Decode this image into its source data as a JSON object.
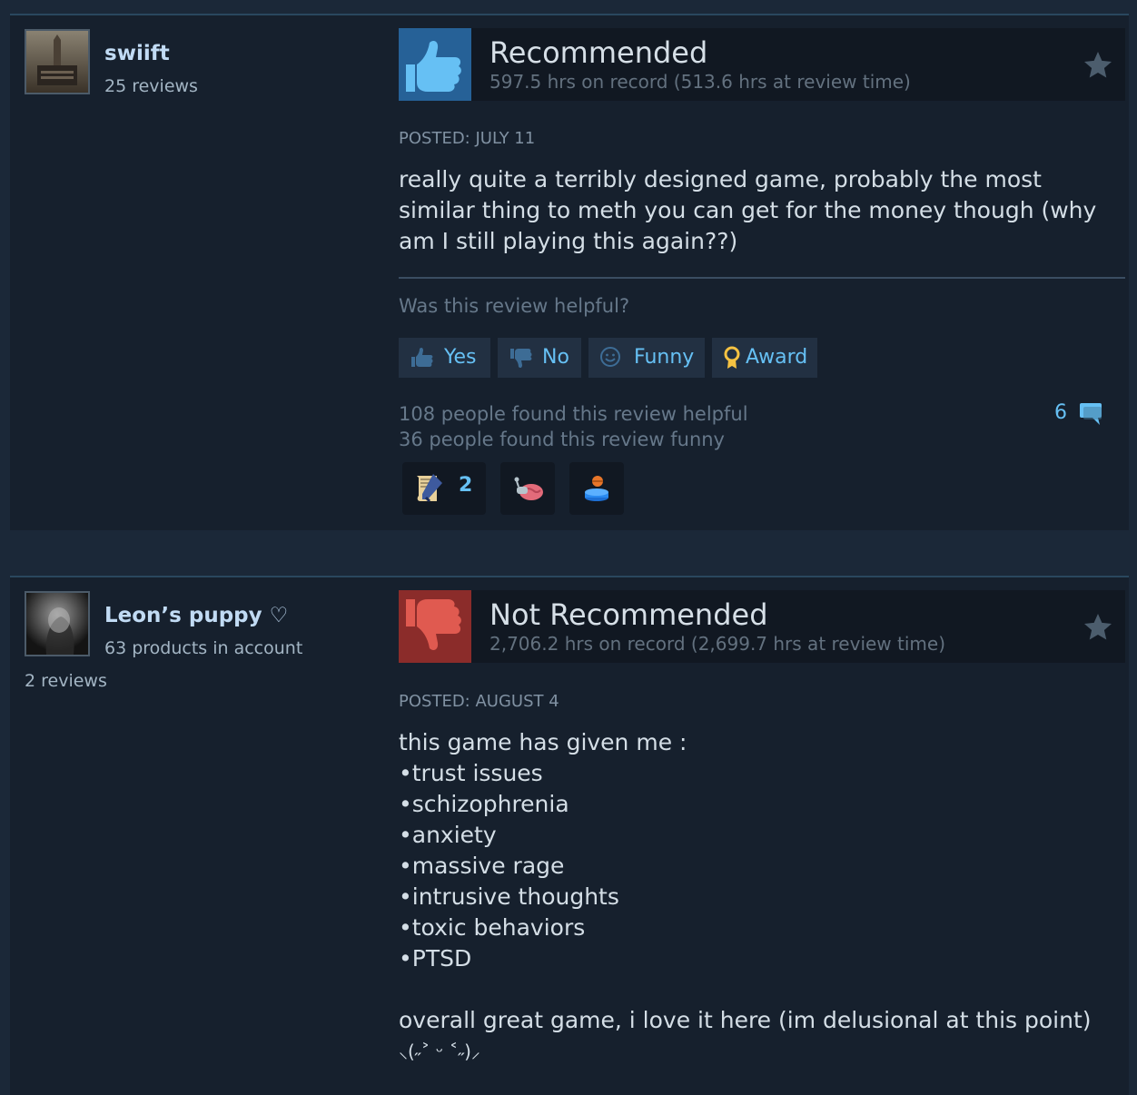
{
  "reviews": [
    {
      "author": {
        "name": "swiift",
        "sub": "25 reviews",
        "extra": ""
      },
      "rating": "Recommended",
      "hours": "597.5 hrs on record (513.6 hrs at review time)",
      "posted": "POSTED: JULY 11",
      "content": "really quite a terribly designed game, probably the most similar thing to meth you can get for the money though (why am I still playing this again??)",
      "helpful_question": "Was this review helpful?",
      "buttons": {
        "yes": "Yes",
        "no": "No",
        "funny": "Funny",
        "award": "Award"
      },
      "helpful_count": "108 people found this review helpful",
      "funny_count": "36 people found this review funny",
      "comment_count": "6",
      "awards": [
        {
          "icon": "scroll-pen-icon",
          "count": "2"
        },
        {
          "icon": "brain-snail-icon",
          "count": ""
        },
        {
          "icon": "pedestal-trophy-icon",
          "count": ""
        }
      ]
    },
    {
      "author": {
        "name": "Leon’s puppy ♡",
        "sub": "63 products in account",
        "extra": "2 reviews"
      },
      "rating": "Not Recommended",
      "hours": "2,706.2 hrs on record (2,699.7 hrs at review time)",
      "posted": "POSTED: AUGUST 4",
      "content_lines": [
        "this game has given me :",
        "•trust issues",
        "•schizophrenia",
        "•anxiety",
        "•massive rage",
        "•intrusive thoughts",
        "•toxic behaviors",
        "•PTSD",
        "",
        "overall great game, i love it here (im delusional at this point)",
        "⸜(˶˃ ᵕ ˂˶)⸝"
      ]
    }
  ],
  "colors": {
    "page_bg": "#1b2838",
    "card_bg": "#16202d",
    "accent_blue": "#66c0f4",
    "thumb_up_bg": "#2a6aa5",
    "thumb_down_bg": "#8b2c2a"
  }
}
